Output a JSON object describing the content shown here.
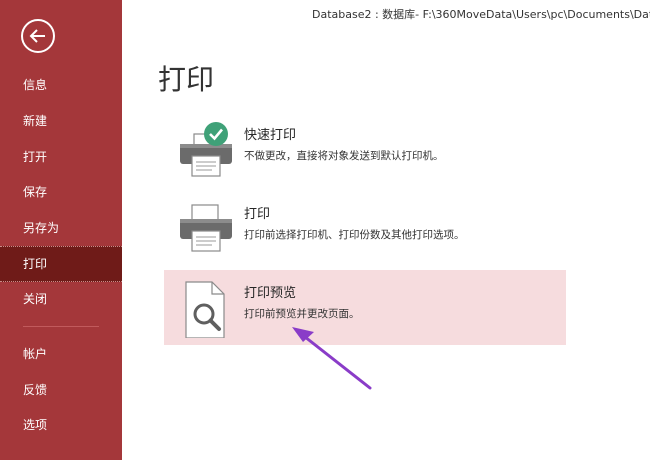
{
  "window": {
    "title": "Database2 : 数据库- F:\\360MoveData\\Users\\pc\\Documents\\Data"
  },
  "sidebar": {
    "items": [
      {
        "label": "信息"
      },
      {
        "label": "新建"
      },
      {
        "label": "打开"
      },
      {
        "label": "保存"
      },
      {
        "label": "另存为"
      },
      {
        "label": "打印",
        "active": true
      },
      {
        "label": "关闭"
      },
      {
        "label": "帐户"
      },
      {
        "label": "反馈"
      },
      {
        "label": "选项"
      }
    ],
    "background_color": "#a4373a",
    "active_color": "#6f1b18"
  },
  "main": {
    "title": "打印",
    "options": [
      {
        "title": "快速打印",
        "description": "不做更改，直接将对象发送到默认打印机。",
        "icon": "quick-print-icon"
      },
      {
        "title": "打印",
        "description": "打印前选择打印机、打印份数及其他打印选项。",
        "icon": "printer-icon"
      },
      {
        "title": "打印预览",
        "description": "打印前预览并更改页面。",
        "icon": "print-preview-icon",
        "selected": true
      }
    ],
    "selected_color": "#f6dcde"
  },
  "annotation": {
    "arrow_color": "#8a3cc8"
  }
}
